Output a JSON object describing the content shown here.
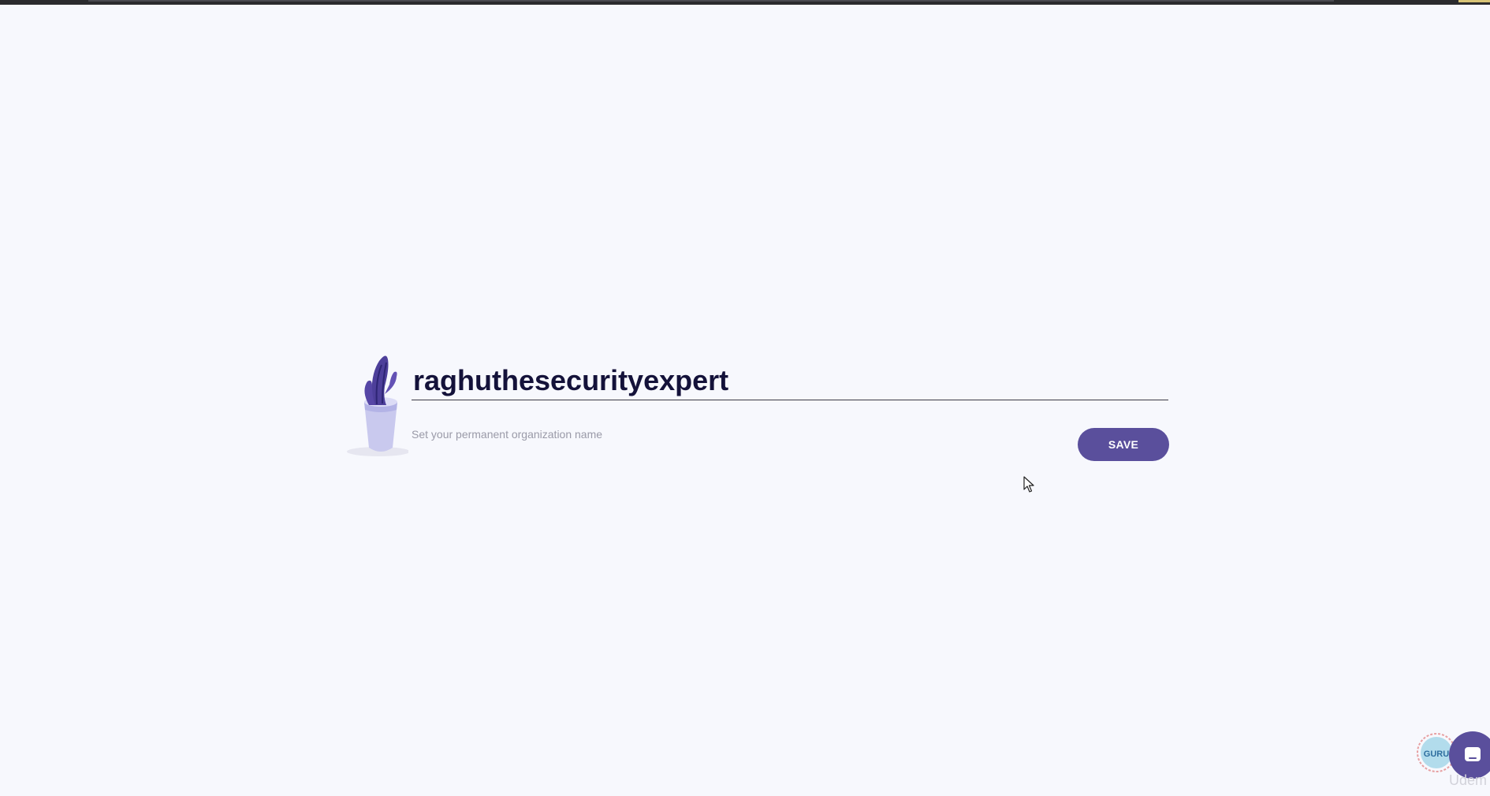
{
  "organization": {
    "name_value": "raghuthesecurityexpert",
    "helper_text": "Set your permanent organization name",
    "save_label": "SAVE"
  },
  "overlay": {
    "watermark_badge_text": "GURU",
    "watermark_text": "Udem"
  },
  "icons": {
    "illustration": "cactus-illustration",
    "cursor": "mouse-pointer-icon",
    "chat": "chat-icon",
    "watermark": "watermark-badge-icon"
  },
  "colors": {
    "background": "#f7f8fd",
    "accent": "#5a4f9c",
    "title_text": "#14123a",
    "helper_text": "#9a9aa8"
  }
}
